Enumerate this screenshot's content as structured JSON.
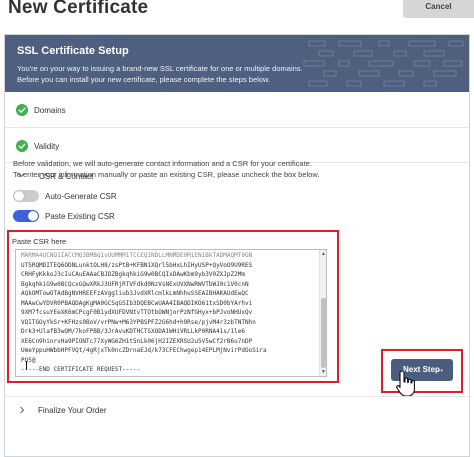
{
  "header": {
    "title": "New Certificate",
    "cancel_label": "Cancel"
  },
  "banner": {
    "title": "SSL Certificate Setup",
    "line1": "You're on your way to issuing a brand-new SSL certificate for one or multiple domains.",
    "line2": "Before you can install your new certificate, please complete the steps below."
  },
  "steps": {
    "domains": "Domains",
    "validity": "Validity",
    "csr_contact": "CSR & Contact",
    "finalize": "Finalize Your Order"
  },
  "csr_section": {
    "desc_line1": "Before validation, we will auto-generate contact information and a CSR for your certificate.",
    "desc_line2": "To enter your information manually or paste an existing CSR, please uncheck the box below.",
    "auto_generate_label": "Auto-Generate CSR",
    "auto_generate_on": false,
    "paste_existing_label": "Paste Existing CSR",
    "paste_existing_on": true,
    "paste_label": "Paste CSR here",
    "csr_lines": [
      "MARMA4UCNQ1IACCMQ3BMBQ1vUUMMM1TCCEQINDLLMNMDE0M1EN1BkTADMAQMT0GN",
      "UTSRQMDITEQ6ODNLunktOLH8/zsPtB+KFBN1XQrl5bHxLhIHyUSP+QyVoO9U9RES",
      "CRHFyKkkoJ3cIuCAuEAAaCBJDZBgkqhkiG9w0BCQIxDAwKbm9yb3V0ZXJpZ2Mm",
      "BgkqhkiG9w0BCQcxGQwXRkJ3UFRjRTVFdkd0NzVsNExUVXNwRWVTbWJ0c1V0cnN",
      "AQkOMTowOTAdBgNVHREEFzAVggliub3JvdXRlcmlkLmNhhuSSEAIBHAKAUdEwQC",
      "MAAwCwYDVR0PBAQDAgKgMA0GCSqGSIb3DQEBCwUAA4IBAQDIKO61txSD0bYArhvi",
      "9XM7fcsuYEeXK6mCPcgF0B1ydXUFDVNtvTTOtbOWNjorPzNfGHyx+bPJvoNHUxQv",
      "VQITGOyYkSr+KFHzs0BoV/vrPNw+M63YPBSPFZ2G6hd+h9Rse/pjvM4r3zbTNTNhn",
      "Drk3+UlafB3wOM/7koFPBB/3JrAvuKDTHCTSXODA1WHiVRLLkP0RNA41s/1le6",
      "XE6Cn9hinrvHa9PIONTc77XyWG6ZH1t5nLk06jH2IZEXRSU2u5V5wCf2rB6u7nDP",
      "UmeYppuHWbbHPFVQt/4gRjxTk0ncZDrnaEJd/k73CFEChwgep14EPLMjNvirPdOoSira",
      "PQ5@",
      "-----END CERTIFICATE REQUEST-----"
    ]
  },
  "actions": {
    "next_label": "Next Step"
  },
  "colors": {
    "banner": "#4e5f7f",
    "check": "#3fb24f",
    "toggle_on": "#3d63d6",
    "highlight": "#e01e2b",
    "next_button": "#4a5d7e"
  },
  "icons": {
    "check": "check-circle-icon",
    "chevron_down": "chevron-down-icon",
    "chevron_right": "chevron-right-icon",
    "arrow_right": "arrow-right-icon",
    "cursor": "hand-pointer-icon"
  }
}
